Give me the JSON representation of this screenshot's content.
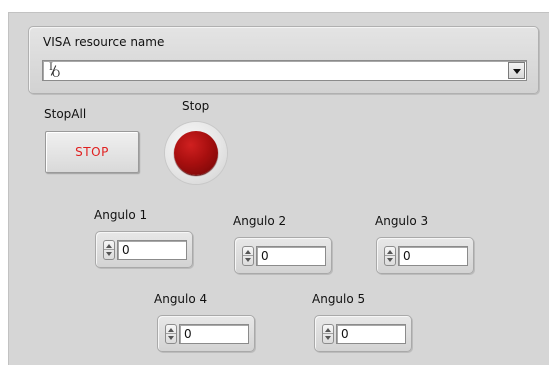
{
  "visa": {
    "label": "VISA resource name",
    "value": "",
    "io_icon_top": "I",
    "io_icon_bottom": "O"
  },
  "stop_all": {
    "label": "StopAll",
    "button_text": "STOP"
  },
  "stop": {
    "label": "Stop",
    "led_color": "#a80f0f"
  },
  "angles": [
    {
      "label": "Angulo 1",
      "value": "0"
    },
    {
      "label": "Angulo 2",
      "value": "0"
    },
    {
      "label": "Angulo 3",
      "value": "0"
    },
    {
      "label": "Angulo 4",
      "value": "0"
    },
    {
      "label": "Angulo 5",
      "value": "0"
    }
  ],
  "colors": {
    "panel_bg": "#d6d6d6",
    "stop_text": "#e02020"
  }
}
